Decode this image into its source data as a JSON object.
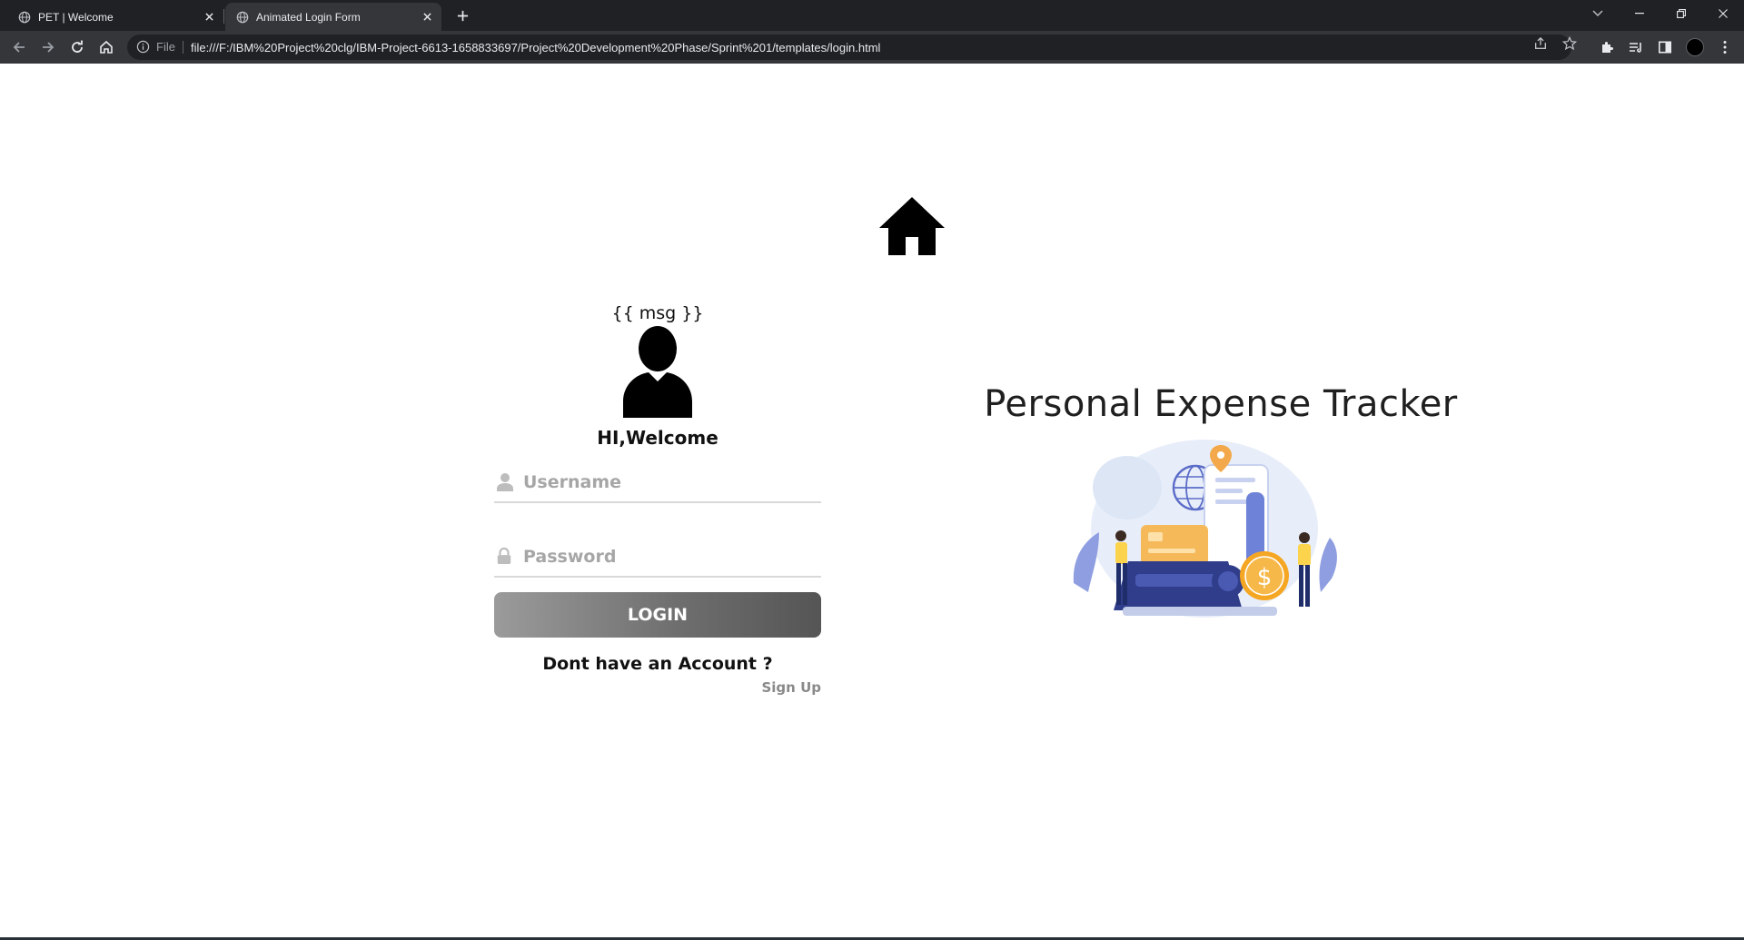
{
  "browser": {
    "tabs": [
      {
        "title": "PET | Welcome",
        "active": false
      },
      {
        "title": "Animated Login Form",
        "active": true
      }
    ],
    "address": {
      "scheme_label": "File",
      "url": "file:///F:/IBM%20Project%20clg/IBM-Project-6613-1658833697/Project%20Development%20Phase/Sprint%201/templates/login.html"
    }
  },
  "page": {
    "message": "{{ msg }}",
    "welcome": "HI,Welcome",
    "username_placeholder": "Username",
    "password_placeholder": "Password",
    "login_label": "LOGIN",
    "no_account_text": "Dont have an Account ?",
    "signup_label": "Sign Up",
    "brand_title": "Personal Expense Tracker"
  },
  "icons": [
    "globe-icon",
    "close-icon",
    "plus-icon",
    "back-icon",
    "forward-icon",
    "reload-icon",
    "home-icon",
    "info-icon",
    "share-icon",
    "star-icon",
    "extensions-icon",
    "reading-list-icon",
    "side-panel-icon",
    "user-icon",
    "lock-icon"
  ],
  "colors": {
    "chrome_dark": "#202124",
    "chrome_toolbar": "#35363a",
    "button_gradient_start": "#9b9b9b",
    "button_gradient_end": "#555555",
    "placeholder_gray": "#a6a6a6"
  }
}
